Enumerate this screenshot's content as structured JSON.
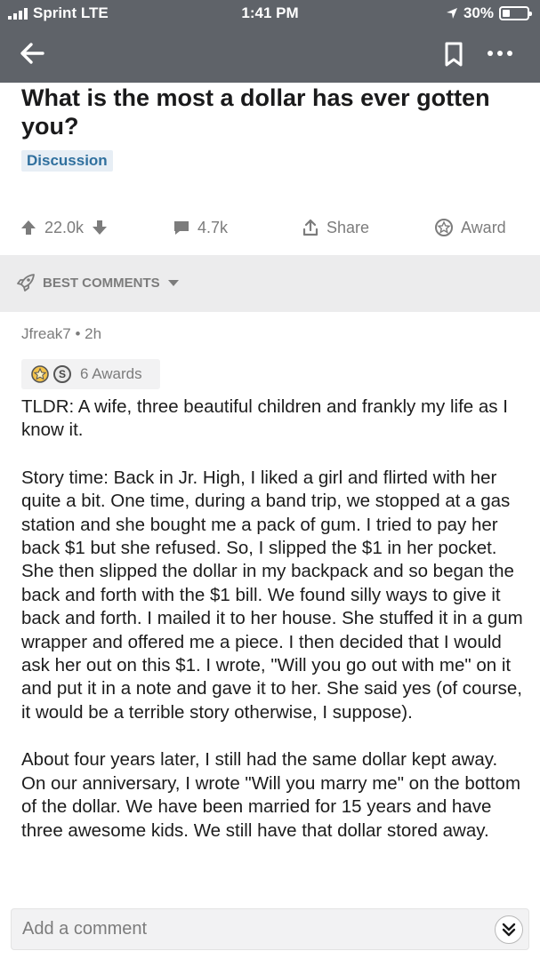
{
  "status_bar": {
    "carrier": "Sprint LTE",
    "time": "1:41 PM",
    "battery": "30%"
  },
  "post": {
    "title": "What is the most a dollar has ever gotten you?",
    "flair": "Discussion",
    "upvotes": "22.0k",
    "comments": "4.7k",
    "share_label": "Share",
    "award_label": "Award"
  },
  "sort": {
    "label": "BEST COMMENTS"
  },
  "comment": {
    "author": "Jfreak7",
    "age": "2h",
    "separator": "•",
    "awards_label": "6 Awards",
    "award_coin": "S",
    "paragraphs": [
      "TLDR: A wife, three beautiful children and frankly my life as I know it.",
      "Story time: Back in Jr. High, I liked a girl and flirted with her quite a bit. One time, during a band trip, we stopped at a gas station and she bought me a pack of gum. I tried to pay her back $1 but she refused. So, I slipped the $1 in her pocket. She then slipped the dollar in my backpack and so began the back and forth with the $1 bill. We found silly ways to give it back and forth. I mailed it to her house. She stuffed it in a gum wrapper and offered me a piece. I then decided that I would ask her out on this $1. I wrote, \"Will you go out with me\" on it and put it in a note and gave it to her. She said yes (of course, it would be a terrible story otherwise, I suppose).",
      "About four years later, I still had the same dollar kept away. On our anniversary, I wrote \"Will you marry me\" on the bottom of the dollar. We have been married for 15 years and have three awesome kids. We still have that dollar stored away."
    ]
  },
  "composer": {
    "placeholder": "Add a comment"
  },
  "icons": {
    "back": "arrow-left-icon",
    "save": "bookmark-icon",
    "more": "more-icon",
    "upvote": "upvote-icon",
    "downvote": "downvote-icon",
    "comments": "comment-bubble-icon",
    "share": "share-icon",
    "award": "award-icon",
    "sort": "rocket-icon",
    "jump": "double-chevron-down-icon"
  },
  "colors": {
    "header": "#5f6369",
    "flair_bg": "#e7eef5",
    "flair_text": "#30709e",
    "muted": "#7c7c7c",
    "sort_bg": "#ececed"
  }
}
